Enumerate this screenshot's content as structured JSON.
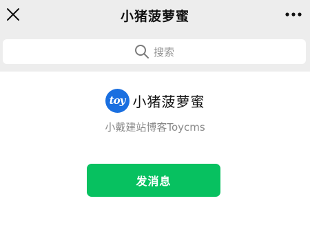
{
  "header": {
    "title": "小猪菠萝蜜",
    "close_icon": "close-icon",
    "more_icon": "more-dots-icon"
  },
  "search": {
    "placeholder": "搜索",
    "icon": "search-icon"
  },
  "profile": {
    "logo_text": "toy",
    "name": "小猪菠萝蜜",
    "description": "小戴建站博客Toycms"
  },
  "actions": {
    "send_message_label": "发消息"
  },
  "colors": {
    "top_background": "#ededed",
    "primary_button": "#07c160",
    "logo_blue": "#1a6fe0"
  }
}
